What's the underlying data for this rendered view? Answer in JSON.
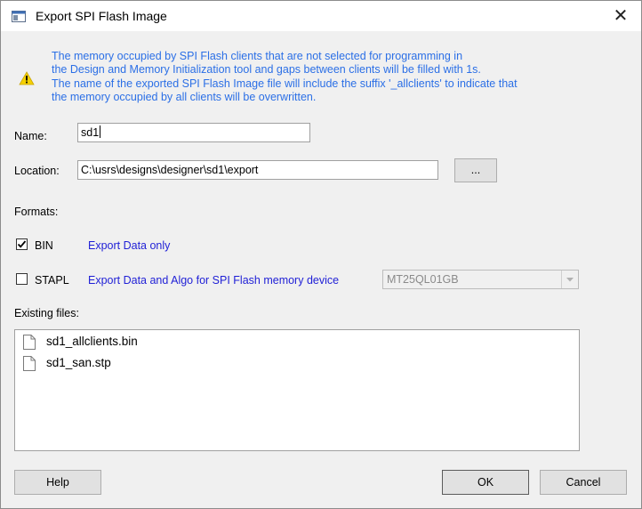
{
  "window": {
    "title": "Export SPI Flash Image",
    "close_glyph": "✕",
    "app_icon": "window-icon"
  },
  "info": {
    "icon": "warning-icon",
    "lines": [
      "The memory occupied by SPI Flash clients that are not selected for programming in",
      "the Design and Memory Initialization tool and gaps between clients will be filled with 1s.",
      "The name of the exported SPI Flash Image file will include the suffix '_allclients' to indicate that",
      "the memory occupied by all clients will be overwritten."
    ],
    "color": "#2b6fe6"
  },
  "name": {
    "label": "Name:",
    "value": "sd1"
  },
  "location": {
    "label": "Location:",
    "value": "C:\\usrs\\designs\\designer\\sd1\\export",
    "browse_label": "..."
  },
  "formats": {
    "label": "Formats:",
    "bin": {
      "label": "BIN",
      "checked": true,
      "description": "Export Data only"
    },
    "stapl": {
      "label": "STAPL",
      "checked": false,
      "description": "Export Data and Algo for SPI Flash memory device",
      "device_selected": "MT25QL01GB"
    }
  },
  "existing_files": {
    "label": "Existing files:",
    "items": [
      {
        "name": "sd1_allclients.bin",
        "icon": "file-icon"
      },
      {
        "name": "sd1_san.stp",
        "icon": "file-icon"
      }
    ]
  },
  "buttons": {
    "help": "Help",
    "ok": "OK",
    "cancel": "Cancel"
  }
}
